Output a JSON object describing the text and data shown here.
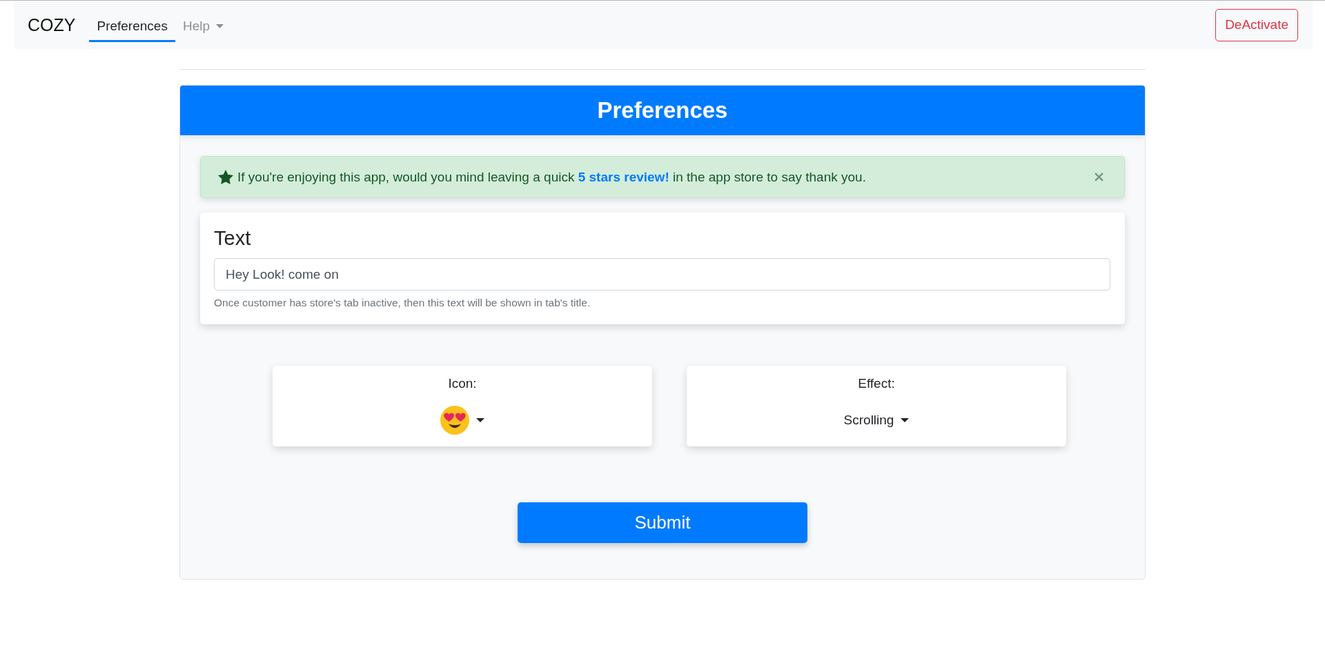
{
  "navbar": {
    "brand": "COZY",
    "items": [
      {
        "label": "Preferences",
        "selected": true,
        "kind": "link"
      },
      {
        "label": "Help",
        "selected": false,
        "kind": "dropdown"
      }
    ],
    "action_button": "DeActivate"
  },
  "card": {
    "title": "Preferences",
    "alert": {
      "text_before": "If you're enjoying this app, would you mind leaving a quick",
      "link": "5 stars review!",
      "text_after": "in the app store to say thank you.",
      "dismissible": true
    },
    "text_field": {
      "label": "Text",
      "value": "Hey Look! come on",
      "help": "Once customer has store's tab inactive, then this text will be shown in tab's title."
    },
    "selectors": [
      {
        "label": "Icon:",
        "kind": "emoji"
      },
      {
        "label": "Effect:",
        "kind": "text",
        "value": "Scrolling"
      }
    ],
    "submit_button": "Submit"
  }
}
